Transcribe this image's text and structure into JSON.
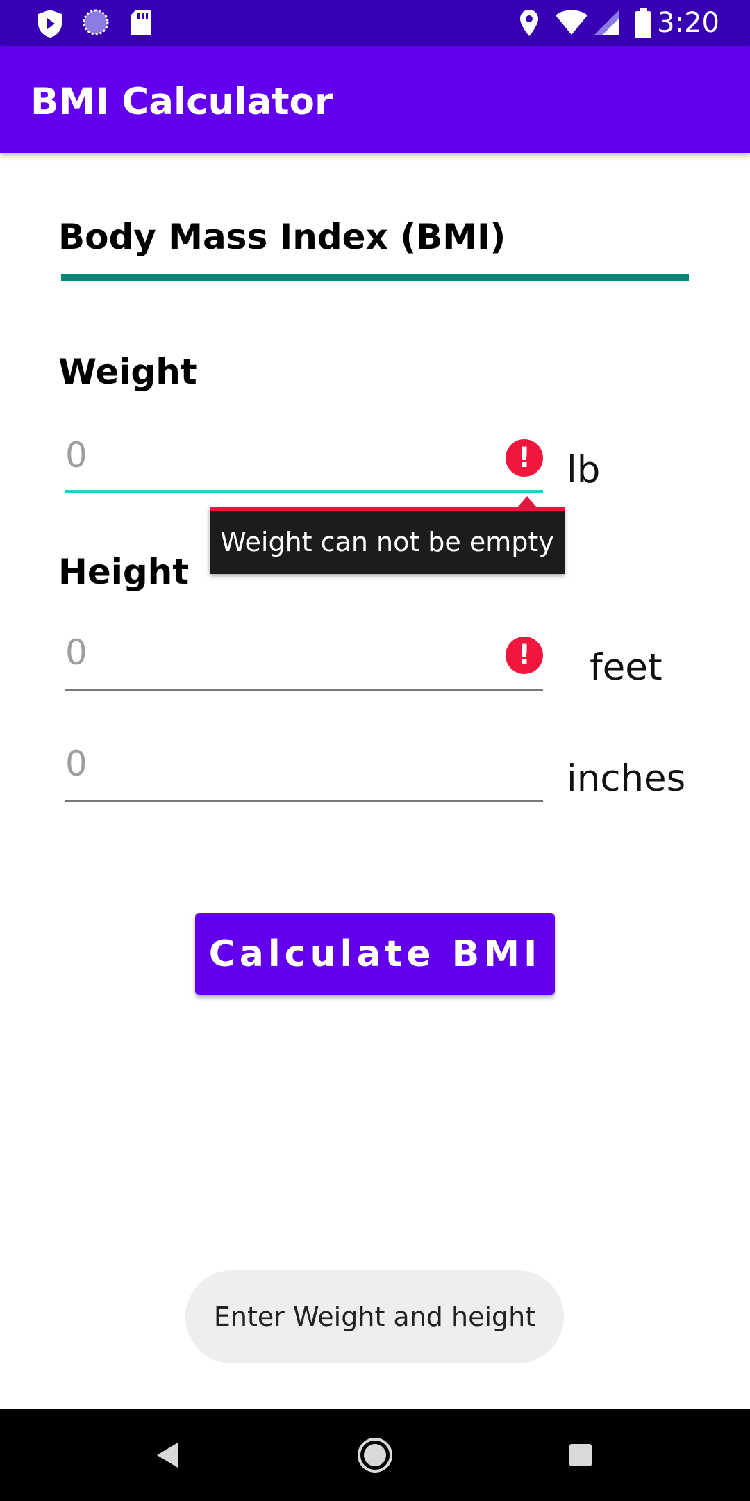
{
  "status_bar": {
    "time": "3:20",
    "icons": [
      "shield-play-icon",
      "loading-circle-icon",
      "sd-card-icon",
      "location-icon",
      "wifi-icon",
      "signal-icon",
      "battery-icon"
    ]
  },
  "app_bar": {
    "title": "BMI Calculator"
  },
  "main": {
    "section_title": "Body Mass Index (BMI)",
    "weight": {
      "label": "Weight",
      "placeholder": "0",
      "unit": "lb",
      "error": "Weight can not be empty"
    },
    "height": {
      "label": "Height",
      "feet_placeholder": "0",
      "feet_unit": "feet",
      "inches_placeholder": "0",
      "inches_unit": "inches"
    },
    "calculate_button": "Calculate BMI"
  },
  "toast": {
    "message": "Enter Weight and height"
  },
  "nav_bar": {
    "icons": [
      "back-icon",
      "home-icon",
      "recents-icon"
    ]
  },
  "colors": {
    "status_bar": "#3700B3",
    "app_bar": "#6200EE",
    "accent_teal": "#00877A",
    "focus_underline": "#26CFC9",
    "error": "#F0163E"
  }
}
